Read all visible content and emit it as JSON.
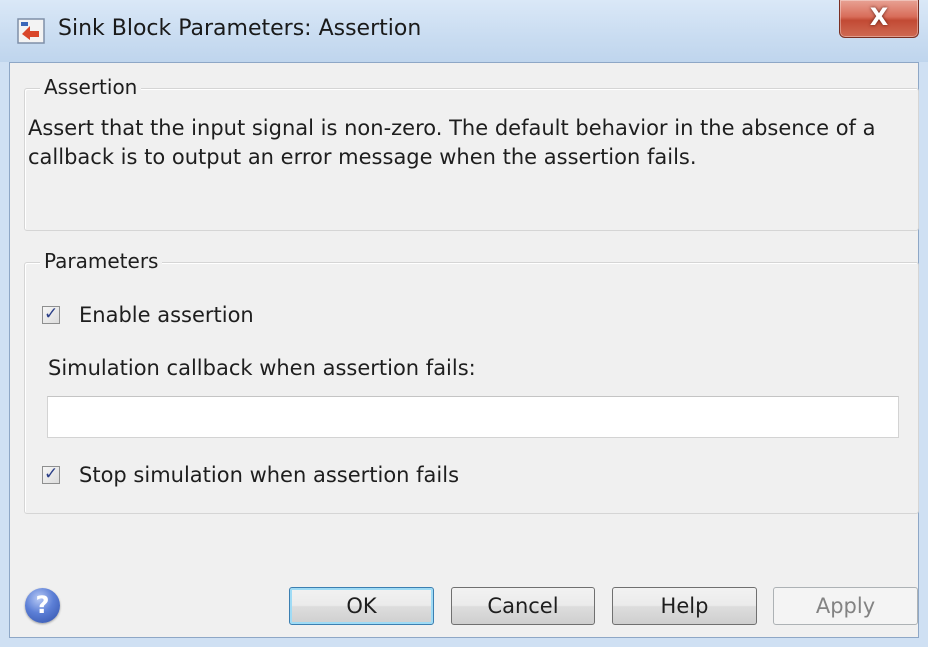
{
  "window": {
    "title": "Sink Block Parameters: Assertion",
    "app_icon": "simulink-block-icon",
    "close_glyph": "X"
  },
  "assertion_group": {
    "title": "Assertion",
    "description": "Assert that the input signal is non-zero.  The default behavior in the absence of a callback is to output an error message when the assertion fails."
  },
  "parameters_group": {
    "title": "Parameters",
    "enable_assertion": {
      "label": "Enable assertion",
      "checked": true
    },
    "callback_field": {
      "label": "Simulation callback when assertion fails:",
      "value": ""
    },
    "stop_simulation": {
      "label": "Stop simulation when assertion fails",
      "checked": true
    }
  },
  "footer": {
    "help_icon": "question-mark-icon",
    "help_glyph": "?",
    "ok_label": "OK",
    "cancel_label": "Cancel",
    "help_label": "Help",
    "apply_label": "Apply"
  },
  "colors": {
    "title_bar": "#cfe0f3",
    "client_bg": "#f0f0f0",
    "close_button": "#c9523d",
    "default_button_border": "#3c7fb1",
    "checkmark": "#2b3f88"
  }
}
